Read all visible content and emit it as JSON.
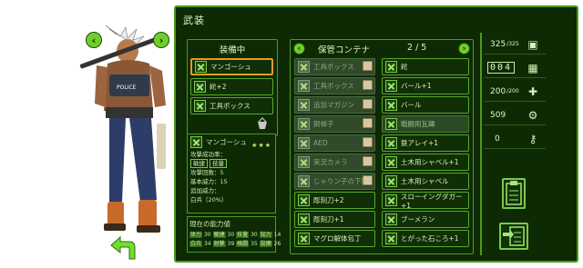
{
  "title": "武装",
  "equipped": {
    "header": "装備中",
    "slots": [
      "マンゴーシュ",
      "鉈+2",
      "工具ボックス"
    ]
  },
  "storage": {
    "header": "保管コンテナ",
    "page": "2 / 5",
    "left": [
      {
        "label": "工具ボックス",
        "dim": true
      },
      {
        "label": "工具ボックス",
        "dim": true
      },
      {
        "label": "追加マガジン",
        "dim": true
      },
      {
        "label": "銅梯子",
        "dim": true
      },
      {
        "label": "AED",
        "dim": true
      },
      {
        "label": "実況カメラ",
        "dim": true
      },
      {
        "label": "じゃりン子の下駄",
        "dim": true
      },
      {
        "label": "彫刻刀+2",
        "dim": false
      },
      {
        "label": "彫刻刀+1",
        "dim": false
      },
      {
        "label": "マグロ解体包丁",
        "dim": false
      }
    ],
    "right": [
      {
        "label": "鉈",
        "dim": false
      },
      {
        "label": "バール+1",
        "dim": false
      },
      {
        "label": "バール",
        "dim": false
      },
      {
        "label": "戦闘用瓦礫",
        "dim": true
      },
      {
        "label": "鉄アレイ+1",
        "dim": false
      },
      {
        "label": "土木用シャベル+1",
        "dim": false
      },
      {
        "label": "土木用シャベル",
        "dim": false
      },
      {
        "label": "スローイングダガー+1",
        "dim": false
      },
      {
        "label": "ブーメラン",
        "dim": false
      },
      {
        "label": "とがった石ころ+1",
        "dim": false
      }
    ]
  },
  "selected": {
    "name": "マンゴーシュ",
    "rarity": "★★★",
    "line1": "攻撃成功率：",
    "tags": [
      "敏捷",
      "技量"
    ],
    "line2": "攻撃回数：5",
    "line3": "基本威力：15",
    "line4": "追加威力：",
    "line5": "白兵（20%）"
  },
  "ability": {
    "label": "現在の能力値",
    "row1": [
      [
        "体力",
        "30"
      ],
      [
        "敏捷",
        "30"
      ],
      [
        "技量",
        "30"
      ],
      [
        "知力",
        "14"
      ]
    ],
    "row2": [
      [
        "白兵",
        "34"
      ],
      [
        "射撃",
        "39"
      ],
      [
        "格闘",
        "35"
      ],
      [
        "投擲",
        "26"
      ]
    ]
  },
  "resources": {
    "r1": "325",
    "r1_max": "/325",
    "r2": "004",
    "r3": "200",
    "r3_max": "/200",
    "r4": "509",
    "r5": "0"
  },
  "nav": {
    "prev": "‹",
    "next": "›",
    "back": "↩"
  },
  "colors": {
    "panel": "#0d2a05",
    "border": "#4d9a1c",
    "selected": "#e59a1e"
  }
}
